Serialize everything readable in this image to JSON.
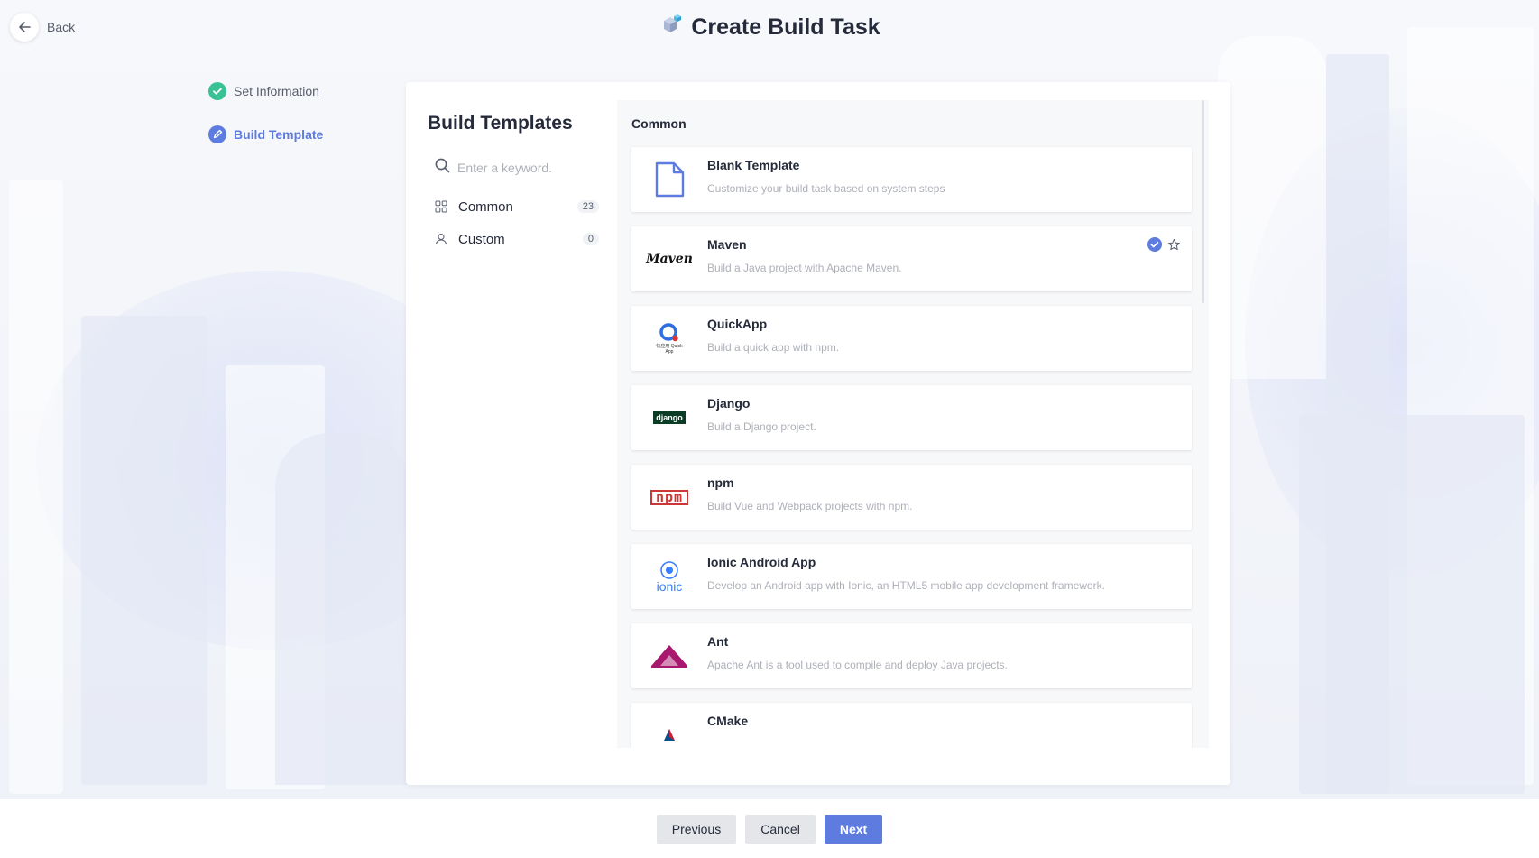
{
  "header": {
    "back_label": "Back",
    "title": "Create Build Task"
  },
  "steps": [
    {
      "label": "Set Information",
      "status": "done"
    },
    {
      "label": "Build Template",
      "status": "active"
    }
  ],
  "sidebar": {
    "title": "Build Templates",
    "search_placeholder": "Enter a keyword.",
    "categories": [
      {
        "label": "Common",
        "count": "23",
        "icon": "grid-icon"
      },
      {
        "label": "Custom",
        "count": "0",
        "icon": "user-icon"
      }
    ]
  },
  "section": {
    "title": "Common"
  },
  "templates": [
    {
      "name": "Blank Template",
      "desc": "Customize your build task based on system steps",
      "logo": "blank-file-icon"
    },
    {
      "name": "Maven",
      "desc": "Build a Java project with Apache Maven.",
      "logo": "maven-logo",
      "logo_text": "Maven",
      "selected": true
    },
    {
      "name": "QuickApp",
      "desc": "Build a quick app with npm.",
      "logo": "quickapp-logo",
      "logo_text": "快应用 Quick App"
    },
    {
      "name": "Django",
      "desc": "Build a Django project.",
      "logo": "django-logo",
      "logo_text": "django"
    },
    {
      "name": "npm",
      "desc": "Build Vue and Webpack projects with npm.",
      "logo": "npm-logo",
      "logo_text": "npm"
    },
    {
      "name": "Ionic Android App",
      "desc": "Develop an Android app with Ionic, an HTML5 mobile app development framework.",
      "logo": "ionic-logo",
      "logo_text": "ionic"
    },
    {
      "name": "Ant",
      "desc": "Apache Ant is a tool used to compile and deploy Java projects.",
      "logo": "ant-logo"
    },
    {
      "name": "CMake",
      "desc": "",
      "logo": "cmake-logo"
    }
  ],
  "footer": {
    "previous_label": "Previous",
    "cancel_label": "Cancel",
    "next_label": "Next"
  },
  "colors": {
    "primary": "#5e7ce0",
    "success": "#3ac295",
    "text": "#252b3a",
    "muted": "#adb0b8"
  }
}
